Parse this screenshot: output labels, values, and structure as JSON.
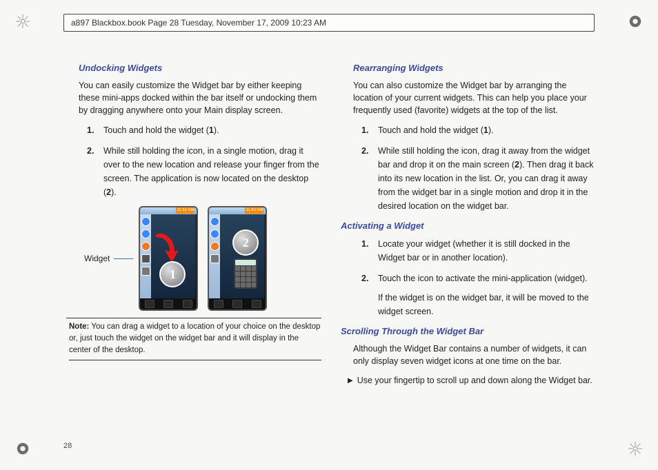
{
  "header": {
    "line": "a897 Blackbox.book  Page 28  Tuesday, November 17, 2009  10:23 AM"
  },
  "page_number": "28",
  "left": {
    "heading": "Undocking Widgets",
    "intro": "You can easily customize the Widget bar by either keeping these mini-apps docked within the bar itself or undocking them by dragging anywhere onto your Main display screen.",
    "steps": [
      {
        "n": "1.",
        "t_pre": "Touch and hold the widget (",
        "bold": "1",
        "t_post": ")."
      },
      {
        "n": "2.",
        "t_pre": "While still holding the icon, in a single motion, drag it over to the new location and release your finger from the screen. The application is now located on the desktop (",
        "bold": "2",
        "t_post": ")."
      }
    ],
    "figure": {
      "label": "Widget",
      "status_time": "11:42 AM",
      "ball1": "1",
      "ball2": "2"
    },
    "note": {
      "label": "Note:",
      "text": " You can drag a widget to a location of your choice on the desktop or, just touch the widget on the widget bar and it will display in the center of the desktop."
    }
  },
  "right": {
    "s1": {
      "heading": "Rearranging Widgets",
      "intro": "You can also customize the Widget bar by arranging the location of your current widgets. This can help you place your frequently used (favorite) widgets at the top of the list.",
      "steps": [
        {
          "n": "1.",
          "t_pre": "Touch and hold the widget (",
          "bold": "1",
          "t_post": ")."
        },
        {
          "n": "2.",
          "t_pre": "While still holding the icon, drag it away from the widget bar and drop it on the main screen (",
          "bold": "2",
          "t_post": "). Then drag it back into its new location in the list. Or, you can drag it away from the widget bar in a single motion and drop it in the desired location on the widget bar."
        }
      ]
    },
    "s2": {
      "heading": "Activating a Widget",
      "steps": [
        {
          "n": "1.",
          "t": "Locate your widget (whether it is still docked in the Widget bar or in another location)."
        },
        {
          "n": "2.",
          "t": "Touch the icon to activate the mini-application (widget)."
        }
      ],
      "tail": "If the widget is on the widget bar, it will be moved to the widget screen."
    },
    "s3": {
      "heading": "Scrolling Through the Widget Bar",
      "intro": "Although the Widget Bar contains a number of widgets, it can only display seven widget icons at one time on the bar.",
      "bullet": "Use your fingertip to scroll up and down along the Widget bar."
    }
  }
}
